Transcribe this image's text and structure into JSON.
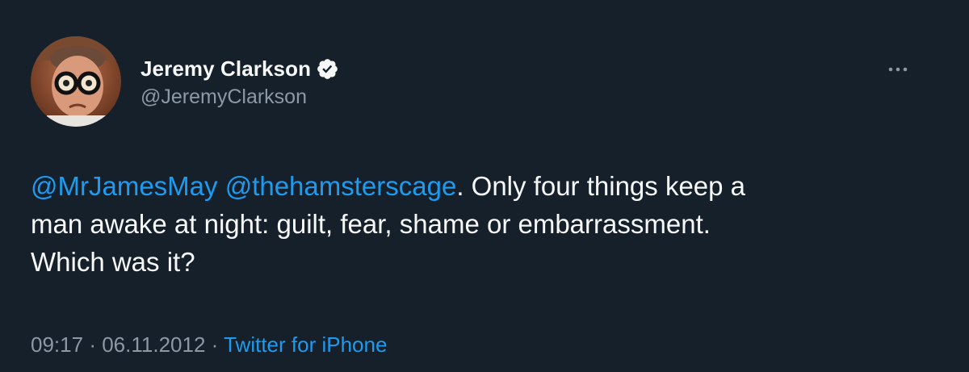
{
  "author": {
    "display_name": "Jeremy Clarkson",
    "handle": "@JeremyClarkson",
    "verified": true,
    "avatar_icon": "profile-photo"
  },
  "tweet": {
    "mention_1": "@MrJamesMay",
    "mention_2": "@thehamsterscage",
    "text_after_mentions": ". Only four things keep a",
    "line_2": "man awake at night: guilt, fear, shame or embarrassment.",
    "line_3": "Which was it?"
  },
  "meta": {
    "time": "09:17",
    "date": "06.11.2012",
    "separator": "·",
    "source": "Twitter for iPhone"
  },
  "icons": {
    "more": "more-options-icon",
    "verified": "verified-badge-icon"
  },
  "colors": {
    "background": "#15202b",
    "accent": "#1d9bf0",
    "secondary_text": "#8b98a5",
    "primary_text": "#f7f9f9"
  }
}
